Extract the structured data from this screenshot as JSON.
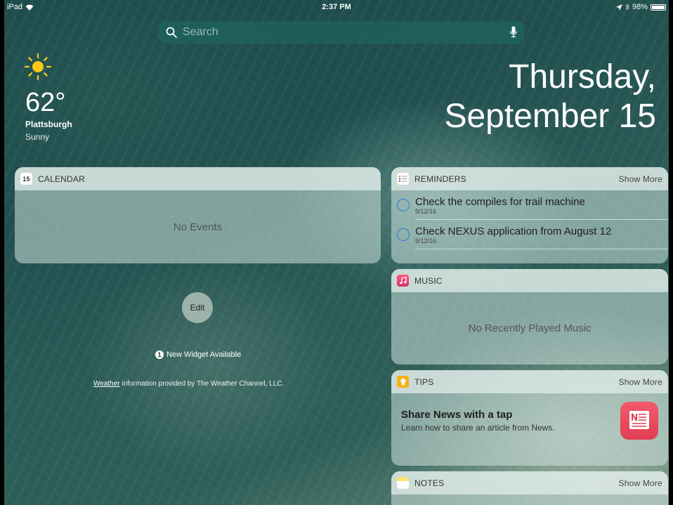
{
  "status_bar": {
    "device": "iPad",
    "time": "2:37 PM",
    "battery": "98%",
    "battery_level": 0.98
  },
  "search": {
    "placeholder": "Search"
  },
  "weather": {
    "temperature": "62°",
    "city": "Plattsburgh",
    "condition": "Sunny"
  },
  "date": {
    "weekday": "Thursday,",
    "day": "September 15"
  },
  "calendar": {
    "title": "CALENDAR",
    "icon_day": "15",
    "empty_text": "No Events"
  },
  "reminders": {
    "title": "REMINDERS",
    "show_more": "Show More",
    "items": [
      {
        "text": "Check the compiles for trail machine",
        "date": "9/12/16"
      },
      {
        "text": "Check NEXUS application from August 12",
        "date": "9/12/16"
      }
    ]
  },
  "music": {
    "title": "MUSIC",
    "empty_text": "No Recently Played Music"
  },
  "tips": {
    "title": "TIPS",
    "show_more": "Show More",
    "heading": "Share News with a tap",
    "subtext": "Learn how to share an article from News."
  },
  "notes": {
    "title": "NOTES",
    "show_more": "Show More"
  },
  "edit": {
    "label": "Edit"
  },
  "new_widget": {
    "badge": "1",
    "label": "New Widget Available"
  },
  "attribution": {
    "link": "Weather",
    "text": " information provided by The Weather Channel, LLC."
  },
  "colors": {
    "reminder_circle": "#2a7ed6",
    "tips_icon": "#f5b014",
    "news_icon": "#e13d52",
    "sun": "#f8c81c"
  }
}
